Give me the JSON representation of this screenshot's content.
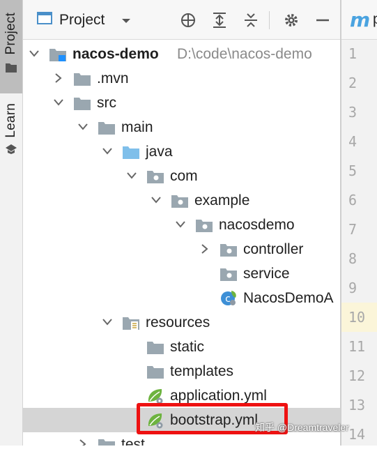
{
  "sidebar": {
    "tabs": [
      {
        "label": "Project",
        "icon": "folder-icon",
        "active": true
      },
      {
        "label": "Learn",
        "icon": "graduation-cap-icon",
        "active": false
      }
    ]
  },
  "toolbar": {
    "view_label": "Project",
    "buttons": [
      "crosshair-icon",
      "expand-all-icon",
      "collapse-all-icon",
      "gear-icon",
      "minimize-icon"
    ]
  },
  "tree": [
    {
      "name": "nacos-demo",
      "path": "D:\\code\\nacos-demo",
      "depth": 0,
      "expander": "down",
      "icon": "module-folder-icon",
      "bold": true
    },
    {
      "name": ".mvn",
      "depth": 1,
      "expander": "right",
      "icon": "folder-icon"
    },
    {
      "name": "src",
      "depth": 1,
      "expander": "down",
      "icon": "folder-icon"
    },
    {
      "name": "main",
      "depth": 2,
      "expander": "down",
      "icon": "folder-icon"
    },
    {
      "name": "java",
      "depth": 3,
      "expander": "down",
      "icon": "source-folder-icon"
    },
    {
      "name": "com",
      "depth": 4,
      "expander": "down",
      "icon": "package-icon"
    },
    {
      "name": "example",
      "depth": 5,
      "expander": "down",
      "icon": "package-icon"
    },
    {
      "name": "nacosdemo",
      "depth": 6,
      "expander": "down",
      "icon": "package-icon"
    },
    {
      "name": "controller",
      "depth": 7,
      "expander": "right",
      "icon": "package-icon"
    },
    {
      "name": "service",
      "depth": 7,
      "expander": "none",
      "icon": "package-icon"
    },
    {
      "name": "NacosDemoA",
      "depth": 7,
      "expander": "none",
      "icon": "spring-class-icon"
    },
    {
      "name": "resources",
      "depth": 3,
      "expander": "down",
      "icon": "resources-folder-icon"
    },
    {
      "name": "static",
      "depth": 4,
      "expander": "none",
      "icon": "folder-icon"
    },
    {
      "name": "templates",
      "depth": 4,
      "expander": "none",
      "icon": "folder-icon"
    },
    {
      "name": "application.yml",
      "depth": 4,
      "expander": "none",
      "icon": "spring-yml-icon"
    },
    {
      "name": "bootstrap.yml",
      "depth": 4,
      "expander": "none",
      "icon": "spring-yml-icon",
      "selected": true
    },
    {
      "name": "test",
      "depth": 2,
      "expander": "right",
      "icon": "folder-icon"
    }
  ],
  "editor": {
    "tab_icon_letter": "m",
    "tab_title": "p",
    "line_numbers": [
      "1",
      "2",
      "3",
      "4",
      "5",
      "6",
      "7",
      "8",
      "9",
      "10",
      "11",
      "12",
      "13",
      "14"
    ],
    "current_line": "10"
  },
  "watermark": "知乎 @Dreamtraveler",
  "colors": {
    "selection": "#d5d5d5",
    "highlight_box": "#ee1111",
    "folder": "#9aa7b0",
    "source_folder": "#7fbfea",
    "spring_green": "#6db33f"
  }
}
